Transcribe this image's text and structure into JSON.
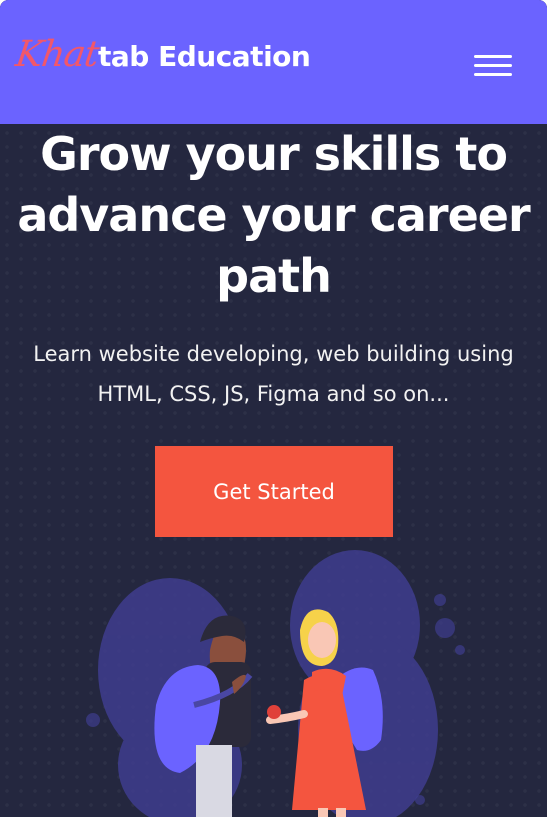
{
  "navbar": {
    "brand_script": "Khat",
    "brand_rest": "tab Education",
    "menu_icon": "hamburger-menu-icon"
  },
  "hero": {
    "headline": "Grow your skills to advance your career path",
    "subline": "Learn website developing, web building using HTML, CSS, JS, Figma and so on...",
    "cta_label": "Get Started"
  },
  "illustration": {
    "subject": "two students with backpacks",
    "colors": {
      "blob": "#4a47a3",
      "backpack": "#6b63ff",
      "dress": "#f4553f",
      "hair_girl": "#f6d24a",
      "hair_boy": "#2b2a3a"
    }
  },
  "colors": {
    "navbar_bg": "#6b63ff",
    "page_bg": "#24273f",
    "accent": "#f4553f",
    "brand_script": "#f2576a"
  }
}
